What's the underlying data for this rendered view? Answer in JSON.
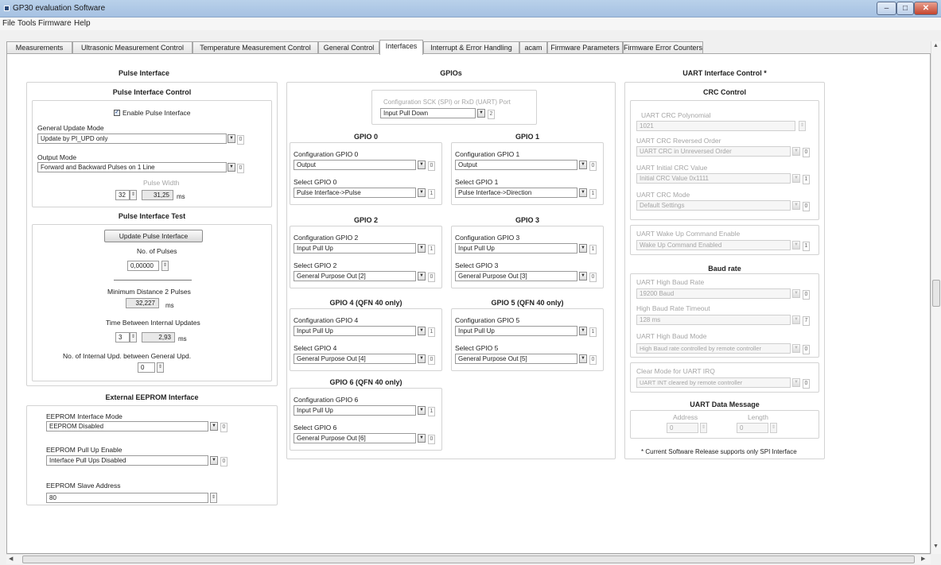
{
  "window": {
    "title": "GP30 evaluation Software",
    "min": "–",
    "max": "□",
    "close": "✕"
  },
  "menu": [
    "File",
    "Tools",
    "Firmware",
    "Help"
  ],
  "tabs": [
    "Measurements",
    "Ultrasonic Measurement Control",
    "Temperature Measurement Control",
    "General Control",
    "Interfaces",
    "Interrupt & Error Handling",
    "acam",
    "Firmware Parameters",
    "Firmware Error Counters"
  ],
  "pulse": {
    "title": "Pulse Interface",
    "control": {
      "title": "Pulse Interface Control",
      "enable_label": "Enable Pulse Interface",
      "enable_checked": true,
      "update_mode_label": "General Update Mode",
      "update_mode_value": "Update by PI_UPD only",
      "update_mode_index": "0",
      "output_mode_label": "Output Mode",
      "output_mode_value": "Forward and Backward Pulses on 1 Line",
      "output_mode_index": "0",
      "width_label": "Pulse Width",
      "width_steps": "32",
      "width_value": "31,25",
      "width_unit": "ms"
    },
    "test": {
      "title": "Pulse Interface Test",
      "update_button": "Update Pulse Interface",
      "pulses_label": "No. of Pulses",
      "pulses_value": "0,00000",
      "min_dist_label": "Minimum Distance 2 Pulses",
      "min_dist_value": "32,227",
      "min_dist_unit": "ms",
      "time_label": "Time Between Internal Updates",
      "time_steps": "3",
      "time_value": "2,93",
      "time_unit": "ms",
      "internal_label": "No. of Internal Upd. between General Upd.",
      "internal_value": "0"
    }
  },
  "eeprom": {
    "title": "External EEPROM Interface",
    "mode_label": "EEPROM Interface Mode",
    "mode_value": "EEPROM Disabled",
    "mode_index": "0",
    "pullup_label": "EEPROM Pull Up Enable",
    "pullup_value": "Interface Pull Ups Disabled",
    "pullup_index": "0",
    "addr_label": "EEPROM Slave Address",
    "addr_value": "80"
  },
  "gpios": {
    "title": "GPIOs",
    "port_label": "Configuration SCK (SPI) or RxD (UART) Port",
    "port_value": "Input Pull Down",
    "port_index": "2",
    "items": [
      {
        "title": "GPIO 0",
        "cfg_label": "Configuration GPIO 0",
        "cfg_value": "Output",
        "cfg_index": "0",
        "sel_label": "Select GPIO 0",
        "sel_value": "Pulse Interface->Pulse",
        "sel_index": "1"
      },
      {
        "title": "GPIO 1",
        "cfg_label": "Configuration GPIO 1",
        "cfg_value": "Output",
        "cfg_index": "0",
        "sel_label": "Select GPIO 1",
        "sel_value": "Pulse Interface->Direction",
        "sel_index": "1"
      },
      {
        "title": "GPIO 2",
        "cfg_label": "Configuration GPIO 2",
        "cfg_value": "Input Pull Up",
        "cfg_index": "1",
        "sel_label": "Select GPIO 2",
        "sel_value": "General Purpose Out [2]",
        "sel_index": "0"
      },
      {
        "title": "GPIO 3",
        "cfg_label": "Configuration GPIO 3",
        "cfg_value": "Input Pull Up",
        "cfg_index": "1",
        "sel_label": "Select GPIO 3",
        "sel_value": "General Purpose Out [3]",
        "sel_index": "0"
      },
      {
        "title": "GPIO 4 (QFN 40 only)",
        "cfg_label": "Configuration GPIO 4",
        "cfg_value": "Input Pull Up",
        "cfg_index": "1",
        "sel_label": "Select GPIO 4",
        "sel_value": "General Purpose Out [4]",
        "sel_index": "0"
      },
      {
        "title": "GPIO 5 (QFN 40 only)",
        "cfg_label": "Configuration GPIO 5",
        "cfg_value": "Input Pull Up",
        "cfg_index": "1",
        "sel_label": "Select GPIO 5",
        "sel_value": "General Purpose Out [5]",
        "sel_index": "0"
      },
      {
        "title": "GPIO 6 (QFN 40 only)",
        "cfg_label": "Configuration GPIO 6",
        "cfg_value": "Input Pull Up",
        "cfg_index": "1",
        "sel_label": "Select GPIO 6",
        "sel_value": "General Purpose Out [6]",
        "sel_index": "0"
      }
    ]
  },
  "uart": {
    "title": "UART Interface Control *",
    "crc": {
      "title": "CRC Control",
      "poly_label": "UART CRC Polynomial",
      "poly_value": "1021",
      "rev_label": "UART CRC Reversed Order",
      "rev_value": "UART CRC in Unreversed Order",
      "rev_index": "0",
      "init_label": "UART Initial CRC Value",
      "init_value": "Initial CRC Value 0x1111",
      "init_index": "1",
      "mode_label": "UART CRC Mode",
      "mode_value": "Default Settings",
      "mode_index": "0"
    },
    "wake": {
      "label": "UART Wake Up Command Enable",
      "value": "Wake Up Command Enabled",
      "index": "1"
    },
    "baud": {
      "title": "Baud rate",
      "high_label": "UART High Baud Rate",
      "high_value": "19200 Baud",
      "high_index": "0",
      "timeout_label": "High Baud Rate Timeout",
      "timeout_value": "128 ms",
      "timeout_index": "7",
      "mode_label": "UART High Baud Mode",
      "mode_value": "High Baud rate controlled by remote controller",
      "mode_index": "0"
    },
    "irq": {
      "label": "Clear Mode for UART IRQ",
      "value": "UART INT cleared by remote controller",
      "index": "0"
    },
    "msg": {
      "title": "UART Data Message",
      "addr_label": "Address",
      "addr_value": "0",
      "len_label": "Length",
      "len_value": "0"
    },
    "note": "* Current Software Release supports only SPI Interface"
  }
}
